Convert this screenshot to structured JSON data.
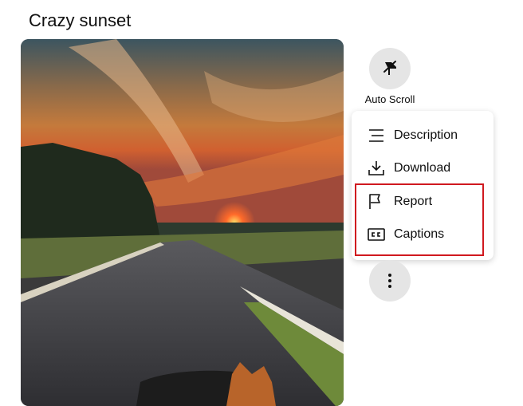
{
  "video": {
    "title": "Crazy sunset"
  },
  "actions": {
    "auto_scroll_label": "Auto Scroll",
    "auto_scroll_icon": "auto-scroll-icon",
    "more_icon": "more-vert-icon"
  },
  "menu": {
    "items": [
      {
        "label": "Description",
        "icon": "description-icon"
      },
      {
        "label": "Download",
        "icon": "download-icon"
      },
      {
        "label": "Report",
        "icon": "flag-icon"
      },
      {
        "label": "Captions",
        "icon": "closed-captions-icon"
      }
    ]
  },
  "colors": {
    "highlight_border": "#d0191f",
    "button_bg": "#e5e5e5"
  }
}
